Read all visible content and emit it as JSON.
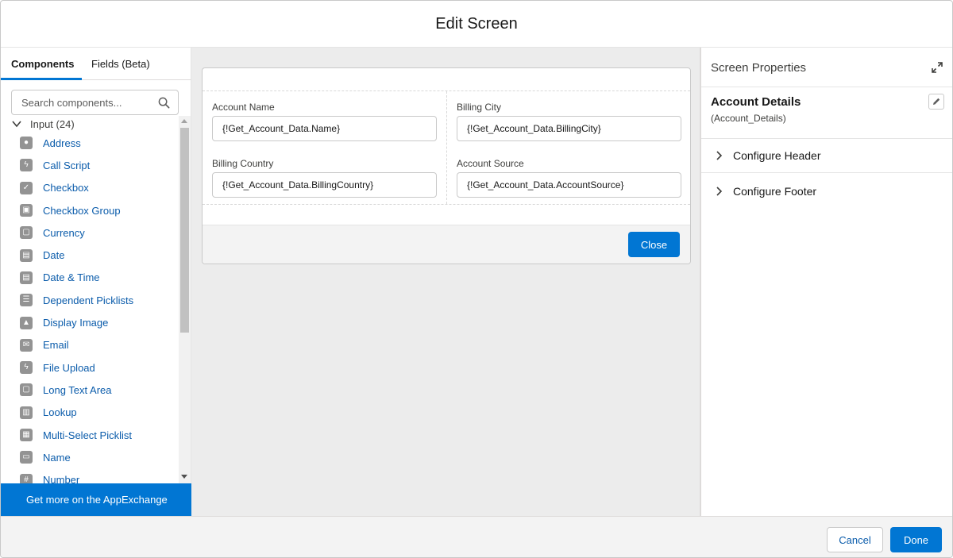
{
  "modal": {
    "title": "Edit Screen"
  },
  "left_panel": {
    "tabs": [
      {
        "label": "Components",
        "active": true
      },
      {
        "label": "Fields (Beta)",
        "active": false
      }
    ],
    "search": {
      "placeholder": "Search components...",
      "value": ""
    },
    "section": {
      "label": "Input (24)",
      "expanded": true
    },
    "items": [
      {
        "label": "Address",
        "icon": "location-icon"
      },
      {
        "label": "Call Script",
        "icon": "lightning-icon"
      },
      {
        "label": "Checkbox",
        "icon": "check-icon"
      },
      {
        "label": "Checkbox Group",
        "icon": "multi-check-icon"
      },
      {
        "label": "Currency",
        "icon": "currency-icon"
      },
      {
        "label": "Date",
        "icon": "calendar-icon"
      },
      {
        "label": "Date & Time",
        "icon": "calendar-time-icon"
      },
      {
        "label": "Dependent Picklists",
        "icon": "picklist-icon"
      },
      {
        "label": "Display Image",
        "icon": "image-icon"
      },
      {
        "label": "Email",
        "icon": "email-icon"
      },
      {
        "label": "File Upload",
        "icon": "lightning-icon"
      },
      {
        "label": "Long Text Area",
        "icon": "textarea-icon"
      },
      {
        "label": "Lookup",
        "icon": "lookup-icon"
      },
      {
        "label": "Multi-Select Picklist",
        "icon": "multi-picklist-icon"
      },
      {
        "label": "Name",
        "icon": "name-icon"
      },
      {
        "label": "Number",
        "icon": "number-icon"
      }
    ],
    "appexchange_label": "Get more on the AppExchange"
  },
  "canvas": {
    "fields": [
      {
        "label": "Account Name",
        "value": "{!Get_Account_Data.Name}"
      },
      {
        "label": "Billing City",
        "value": "{!Get_Account_Data.BillingCity}"
      },
      {
        "label": "Billing Country",
        "value": "{!Get_Account_Data.BillingCountry}"
      },
      {
        "label": "Account Source",
        "value": "{!Get_Account_Data.AccountSource}"
      }
    ],
    "close_label": "Close"
  },
  "properties": {
    "title": "Screen Properties",
    "screen_label": "Account Details",
    "screen_api": "(Account_Details)",
    "sections": [
      {
        "label": "Configure Header"
      },
      {
        "label": "Configure Footer"
      }
    ]
  },
  "footer": {
    "cancel_label": "Cancel",
    "done_label": "Done"
  },
  "colors": {
    "brand": "#0176d3",
    "link": "#0b5cab",
    "canvas_bg": "#ececec"
  }
}
